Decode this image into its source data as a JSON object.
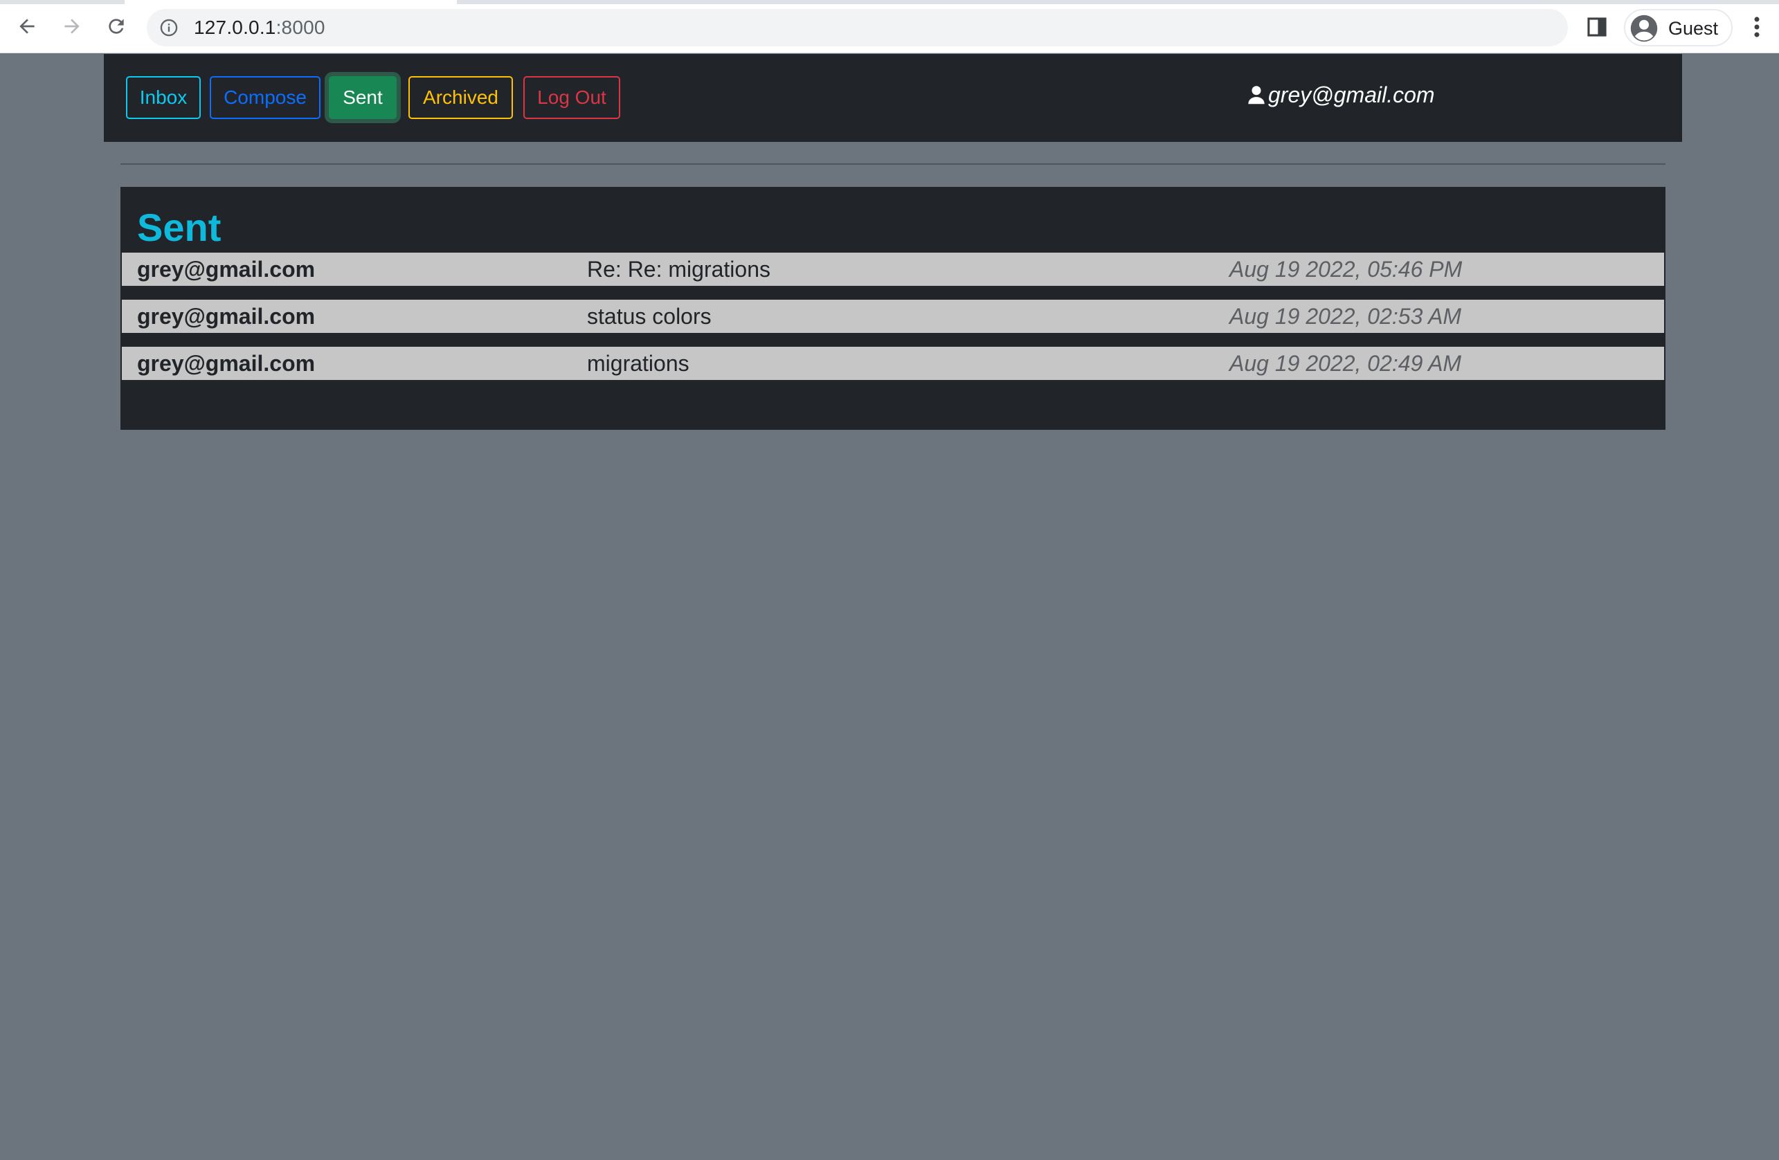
{
  "browser": {
    "url_host": "127.0.0.1",
    "url_port": ":8000",
    "profile_label": "Guest"
  },
  "nav": {
    "inbox_label": "Inbox",
    "compose_label": "Compose",
    "sent_label": "Sent",
    "archived_label": "Archived",
    "logout_label": "Log Out",
    "active": "Sent"
  },
  "user": {
    "email": "grey@gmail.com"
  },
  "mailbox": {
    "title": "Sent",
    "emails": [
      {
        "sender": "grey@gmail.com",
        "subject": "Re: Re: migrations",
        "timestamp": "Aug 19 2022, 05:46 PM"
      },
      {
        "sender": "grey@gmail.com",
        "subject": "status colors",
        "timestamp": "Aug 19 2022, 02:53 AM"
      },
      {
        "sender": "grey@gmail.com",
        "subject": "migrations",
        "timestamp": "Aug 19 2022, 02:49 AM"
      }
    ]
  },
  "colors": {
    "page_bg": "#6c757d",
    "panel_bg": "#212529",
    "row_bg": "#c6c6c6",
    "inbox": "#0dcaf0",
    "compose": "#0d6efd",
    "sent": "#198754",
    "archived": "#ffc107",
    "logout": "#dc3545"
  },
  "icons": {
    "back": "arrow-left-icon",
    "forward": "arrow-right-icon",
    "reload": "reload-icon",
    "site_info": "info-icon",
    "side_panel": "side-panel-icon",
    "profile": "account-circle-icon",
    "menu": "more-vertical-icon",
    "user": "person-icon"
  }
}
